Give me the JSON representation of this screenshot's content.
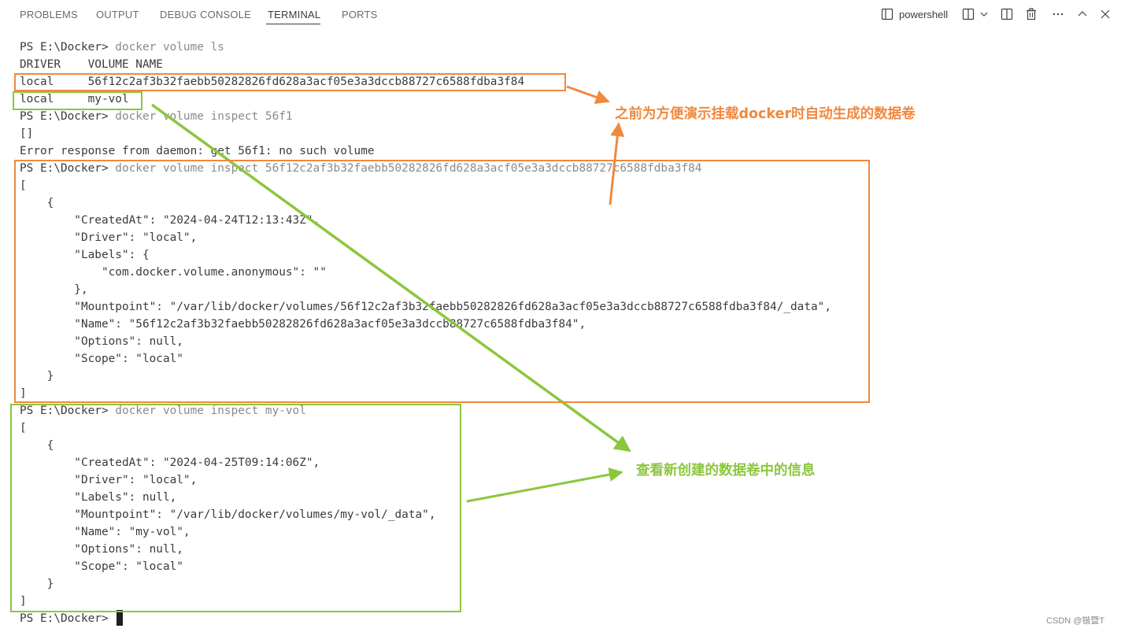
{
  "panel": {
    "tabs": [
      {
        "label": "PROBLEMS"
      },
      {
        "label": "OUTPUT"
      },
      {
        "label": "DEBUG CONSOLE"
      },
      {
        "label": "TERMINAL",
        "active": true
      },
      {
        "label": "PORTS"
      }
    ],
    "toolbar": {
      "shell_label": "powershell",
      "icons": [
        "terminal-layout-icon",
        "split-terminal-icon",
        "chevron-down-icon",
        "split-editor-icon",
        "trash-icon",
        "more-icon",
        "maximize-panel-icon",
        "close-icon"
      ]
    }
  },
  "terminal": {
    "lines": [
      {
        "prompt": "PS E:\\Docker> ",
        "cmd": "docker volume ls"
      },
      {
        "text": "DRIVER    VOLUME NAME"
      },
      {
        "text": "local     56f12c2af3b32faebb50282826fd628a3acf05e3a3dccb88727c6588fdba3f84"
      },
      {
        "text": "local     my-vol"
      },
      {
        "prompt": "PS E:\\Docker> ",
        "cmd": "docker volume inspect 56f1"
      },
      {
        "text": "[]"
      },
      {
        "text": "Error response from daemon: get 56f1: no such volume"
      },
      {
        "prompt": "PS E:\\Docker> ",
        "cmd": "docker volume inspect 56f12c2af3b32faebb50282826fd628a3acf05e3a3dccb88727c6588fdba3f84"
      },
      {
        "text": "["
      },
      {
        "text": "    {"
      },
      {
        "text": "        \"CreatedAt\": \"2024-04-24T12:13:43Z\","
      },
      {
        "text": "        \"Driver\": \"local\","
      },
      {
        "text": "        \"Labels\": {"
      },
      {
        "text": "            \"com.docker.volume.anonymous\": \"\""
      },
      {
        "text": "        },"
      },
      {
        "text": "        \"Mountpoint\": \"/var/lib/docker/volumes/56f12c2af3b32faebb50282826fd628a3acf05e3a3dccb88727c6588fdba3f84/_data\","
      },
      {
        "text": "        \"Name\": \"56f12c2af3b32faebb50282826fd628a3acf05e3a3dccb88727c6588fdba3f84\","
      },
      {
        "text": "        \"Options\": null,"
      },
      {
        "text": "        \"Scope\": \"local\""
      },
      {
        "text": "    }"
      },
      {
        "text": "]"
      },
      {
        "prompt": "PS E:\\Docker> ",
        "cmd": "docker volume inspect my-vol"
      },
      {
        "text": "["
      },
      {
        "text": "    {"
      },
      {
        "text": "        \"CreatedAt\": \"2024-04-25T09:14:06Z\","
      },
      {
        "text": "        \"Driver\": \"local\","
      },
      {
        "text": "        \"Labels\": null,"
      },
      {
        "text": "        \"Mountpoint\": \"/var/lib/docker/volumes/my-vol/_data\","
      },
      {
        "text": "        \"Name\": \"my-vol\","
      },
      {
        "text": "        \"Options\": null,"
      },
      {
        "text": "        \"Scope\": \"local\""
      },
      {
        "text": "    }"
      },
      {
        "text": "]"
      },
      {
        "prompt": "PS E:\\Docker> ",
        "cmd": "",
        "cursor": true
      }
    ]
  },
  "annotations": {
    "orange_note": "之前为方便演示挂载docker时自动生成的数据卷",
    "green_note": "查看新创建的数据卷中的信息",
    "orange_color": "#f0883e",
    "green_color": "#8cc63e"
  },
  "watermark": "CSDN @锴暨T"
}
